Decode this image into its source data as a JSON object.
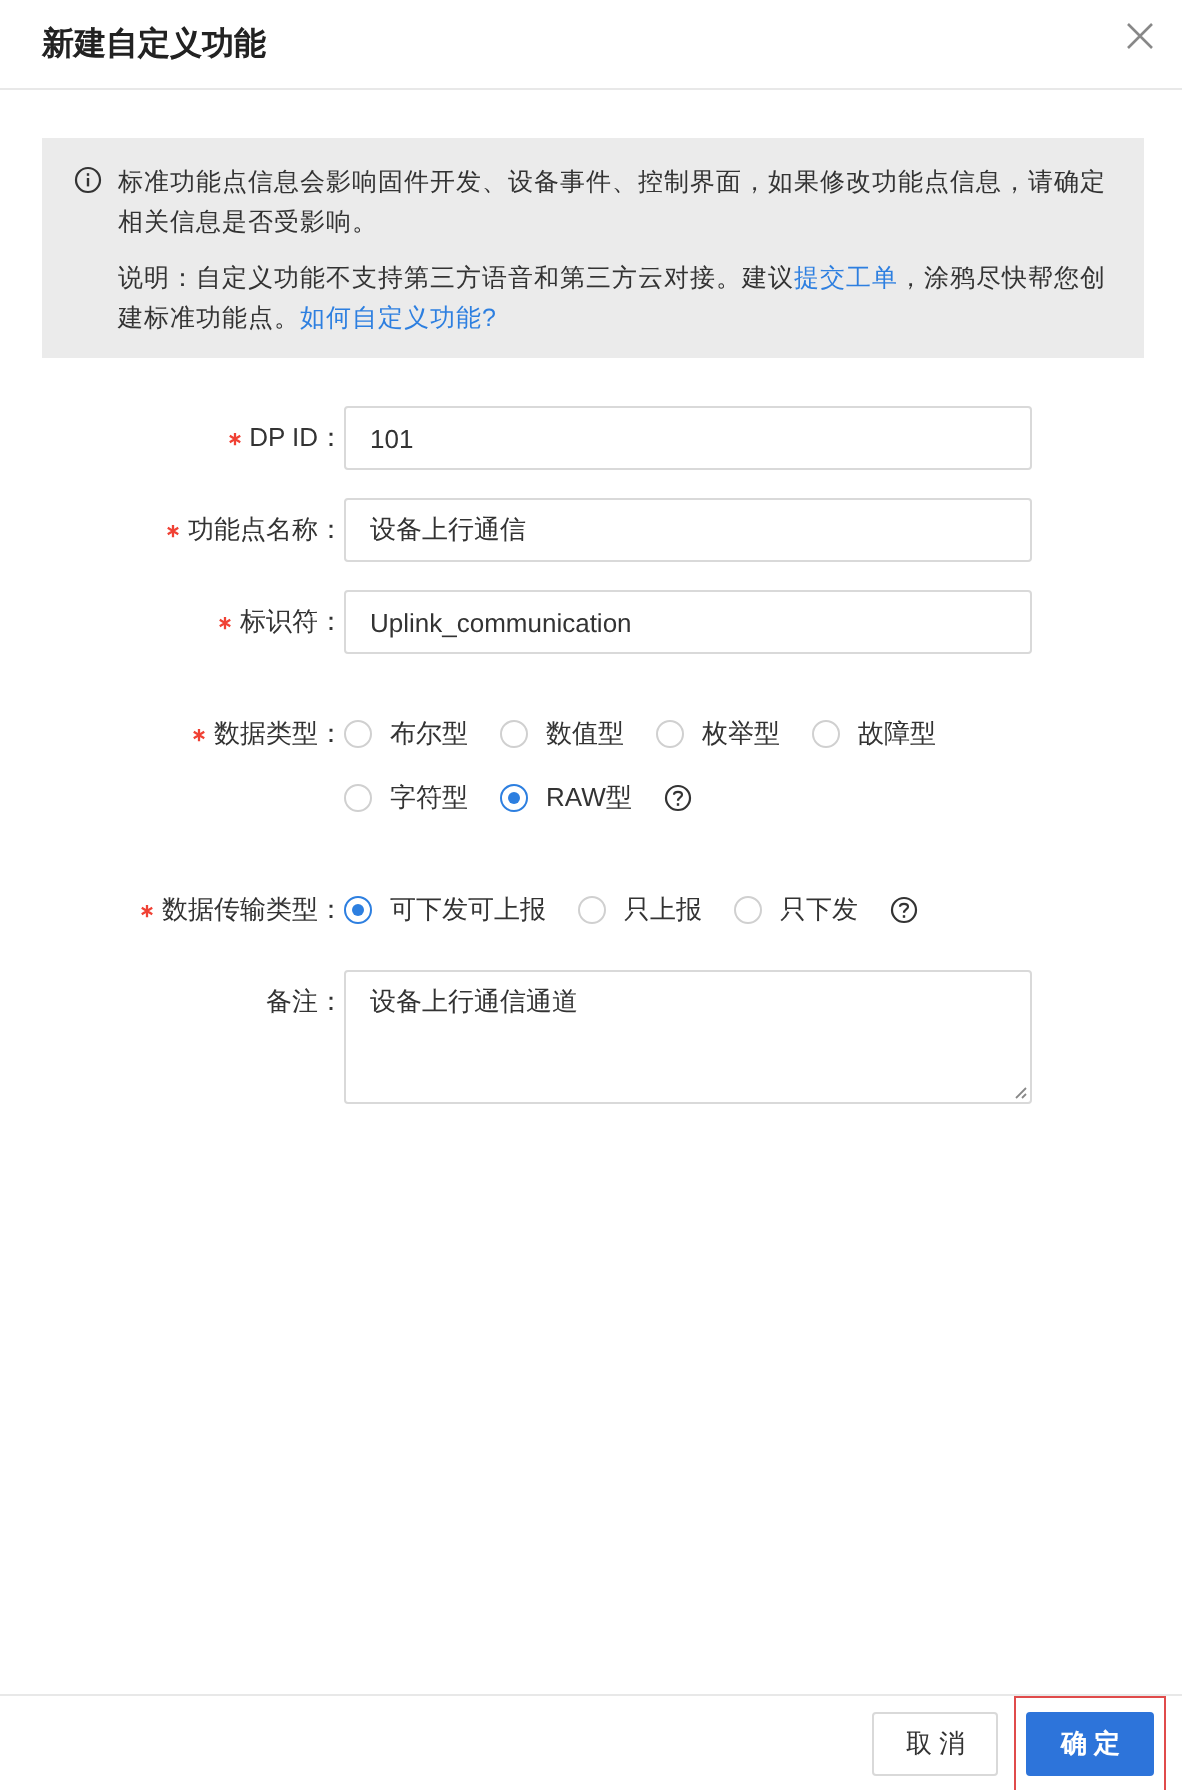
{
  "dialog": {
    "title": "新建自定义功能"
  },
  "notice": {
    "paragraphs": [
      {
        "parts": [
          {
            "text": "标准功能点信息会影响固件开发、设备事件、控制界面，如果修改功能点信息，请确定相关信息是否受影响。",
            "link": false
          }
        ]
      },
      {
        "parts": [
          {
            "text": "说明：自定义功能不支持第三方语音和第三方云对接。建议",
            "link": false
          },
          {
            "text": "提交工单",
            "link": true
          },
          {
            "text": "，涂鸦尽快帮您创建标准功能点。",
            "link": false
          },
          {
            "text": "如何自定义功能?",
            "link": true
          }
        ]
      }
    ]
  },
  "fields": [
    {
      "kind": "text",
      "label": "DP ID：",
      "required": true,
      "value": "101"
    },
    {
      "kind": "text",
      "label": "功能点名称：",
      "required": true,
      "value": "设备上行通信"
    },
    {
      "kind": "text",
      "label": "标识符：",
      "required": true,
      "value": "Uplink_communication"
    },
    {
      "kind": "radio",
      "label": "数据类型：",
      "required": true,
      "help": true,
      "options": [
        {
          "label": "布尔型",
          "selected": false
        },
        {
          "label": "数值型",
          "selected": false
        },
        {
          "label": "枚举型",
          "selected": false
        },
        {
          "label": "故障型",
          "selected": false
        },
        {
          "label": "字符型",
          "selected": false
        },
        {
          "label": "RAW型",
          "selected": true
        }
      ]
    },
    {
      "kind": "radio",
      "label": "数据传输类型：",
      "required": true,
      "help": true,
      "options": [
        {
          "label": "可下发可上报",
          "selected": true
        },
        {
          "label": "只上报",
          "selected": false
        },
        {
          "label": "只下发",
          "selected": false
        }
      ]
    },
    {
      "kind": "textarea",
      "label": "备注：",
      "required": false,
      "value": "设备上行通信通道"
    }
  ],
  "buttons": [
    {
      "label": "取 消",
      "kind": "secondary",
      "highlighted": false
    },
    {
      "label": "确 定",
      "kind": "primary",
      "highlighted": true
    }
  ]
}
